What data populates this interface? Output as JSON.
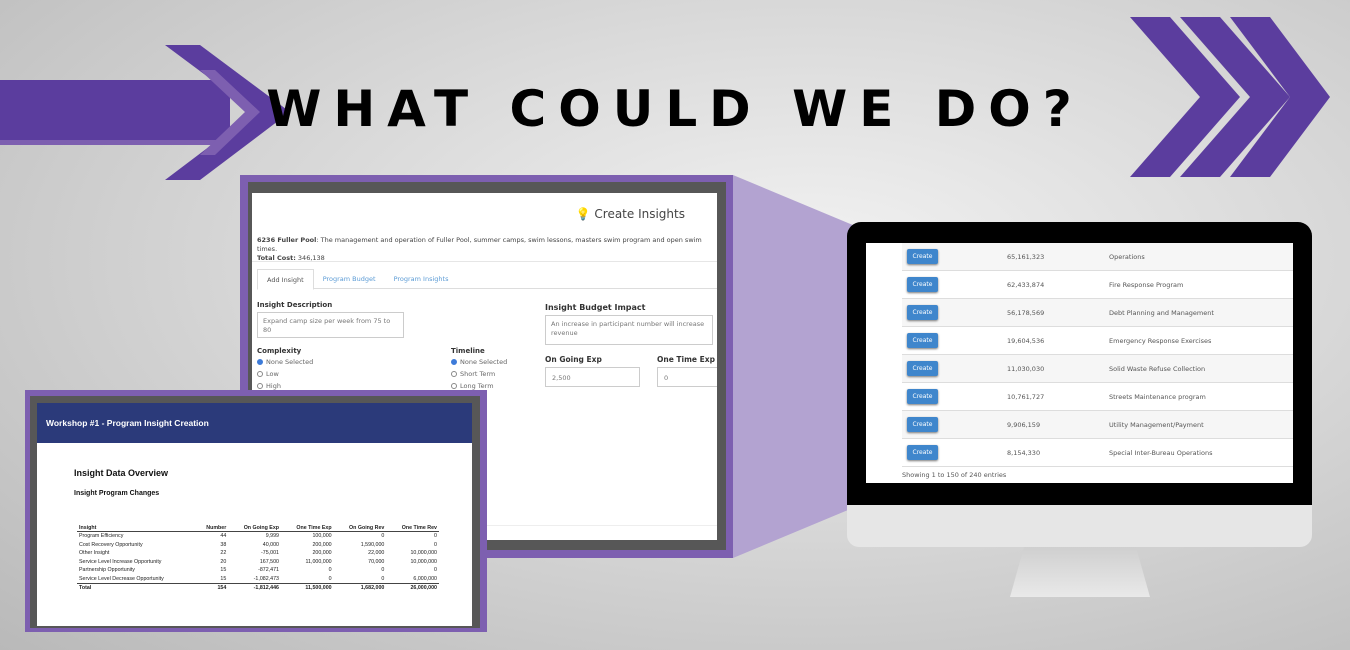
{
  "slide": {
    "title": "WHAT COULD WE DO?",
    "accent_color": "#5b3d9e",
    "connector_color": "#b3a3d1"
  },
  "create_insights": {
    "header": "Create Insights",
    "header_icon": "lightbulb-icon",
    "program_name": "6236 Fuller Pool",
    "program_description": ": The management and operation of Fuller Pool, summer camps, swim lessons, masters swim program and open swim times.",
    "total_cost_label": "Total Cost:",
    "total_cost": "346,138",
    "tabs": [
      "Add Insight",
      "Program Budget",
      "Program Insights"
    ],
    "insight_description_label": "Insight Description",
    "insight_description": "Expand camp size per week from 75 to 80",
    "complexity_label": "Complexity",
    "complexity_options": [
      "None Selected",
      "Low",
      "High"
    ],
    "timeline_label": "Timeline",
    "timeline_options": [
      "None Selected",
      "Short Term",
      "Long Term"
    ],
    "budget_impact_label": "Insight Budget Impact",
    "budget_impact": "An increase in participant number will increase revenue",
    "ongoing_exp_label": "On Going Exp",
    "ongoing_exp": "2,500",
    "one_time_exp_label": "One Time Exp",
    "one_time_exp": "0"
  },
  "program_list": {
    "button_label": "Create",
    "rows": [
      {
        "amount": "65,161,323",
        "name": "Operations"
      },
      {
        "amount": "62,433,874",
        "name": "Fire Response Program"
      },
      {
        "amount": "56,178,569",
        "name": "Debt Planning and Management"
      },
      {
        "amount": "19,604,536",
        "name": "Emergency Response Exercises"
      },
      {
        "amount": "11,030,030",
        "name": "Solid Waste Refuse Collection"
      },
      {
        "amount": "10,761,727",
        "name": "Streets Maintenance program"
      },
      {
        "amount": "9,906,159",
        "name": "Utility Management/Payment"
      },
      {
        "amount": "8,154,330",
        "name": "Special Inter-Bureau Operations"
      }
    ],
    "footer": "Showing 1 to 150 of 240 entries"
  },
  "report": {
    "header": "Workshop #1 - Program Insight Creation",
    "title": "Insight Data Overview",
    "subtitle": "Insight Program Changes",
    "columns": [
      "Insight",
      "Number",
      "On Going Exp",
      "One Time Exp",
      "On Going Rev",
      "One Time Rev"
    ],
    "rows": [
      [
        "Program Efficiency",
        "44",
        "9,999",
        "100,000",
        "0",
        "0"
      ],
      [
        "Cost Recovery Opportunity",
        "38",
        "40,000",
        "200,000",
        "1,590,000",
        "0"
      ],
      [
        "Other Insight",
        "22",
        "-75,001",
        "200,000",
        "22,000",
        "10,000,000"
      ],
      [
        "Service Level Increase Opportunity",
        "20",
        "167,500",
        "11,000,000",
        "70,000",
        "10,000,000"
      ],
      [
        "Partnership Opportunity",
        "15",
        "-872,471",
        "0",
        "0",
        "0"
      ],
      [
        "Service Level Decrease Opportunity",
        "15",
        "-1,082,473",
        "0",
        "0",
        "6,000,000"
      ]
    ],
    "total": [
      "Total",
      "154",
      "-1,812,446",
      "11,500,000",
      "1,682,000",
      "26,000,000"
    ]
  }
}
